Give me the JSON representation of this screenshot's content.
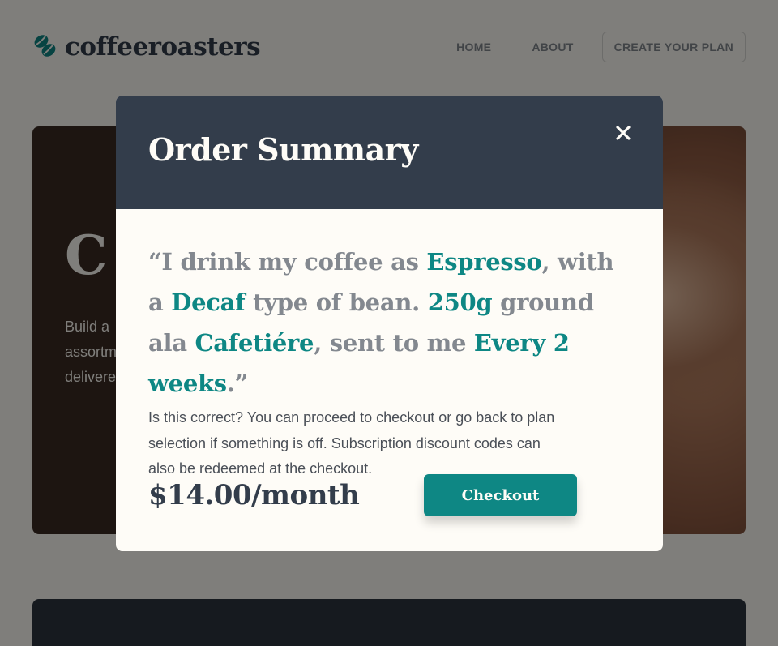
{
  "header": {
    "logo_text": "coffeeroasters",
    "nav": [
      {
        "label": "HOME"
      },
      {
        "label": "ABOUT"
      },
      {
        "label": "CREATE YOUR PLAN"
      }
    ]
  },
  "hero": {
    "title_partial": "C",
    "text_lines": [
      "Build a",
      "assortm",
      "delivere"
    ]
  },
  "modal": {
    "title": "Order Summary",
    "summary": {
      "open_quote": "“",
      "p1": "I drink my coffee as ",
      "preference": "Espresso",
      "p2": ", with a ",
      "bean_type": "Decaf",
      "p3": " type of bean. ",
      "quantity": "250g",
      "p4": " ground ala ",
      "grind": "Cafetiére",
      "p5": ", sent to me ",
      "delivery": "Every 2 weeks",
      "p6": ".",
      "close_quote": "”"
    },
    "note": "Is this correct? You can proceed to checkout or go back to plan selection if something is off. Subscription discount codes can also be redeemed at the checkout.",
    "price": "$14.00/month",
    "checkout_label": "Checkout"
  },
  "colors": {
    "accent": "#0e8784",
    "dark_blue": "#333d4b",
    "grey": "#83888f",
    "light_cream": "#fefcf7"
  },
  "icons": {
    "logo": "coffee-bean-icon",
    "close": "close-icon"
  }
}
